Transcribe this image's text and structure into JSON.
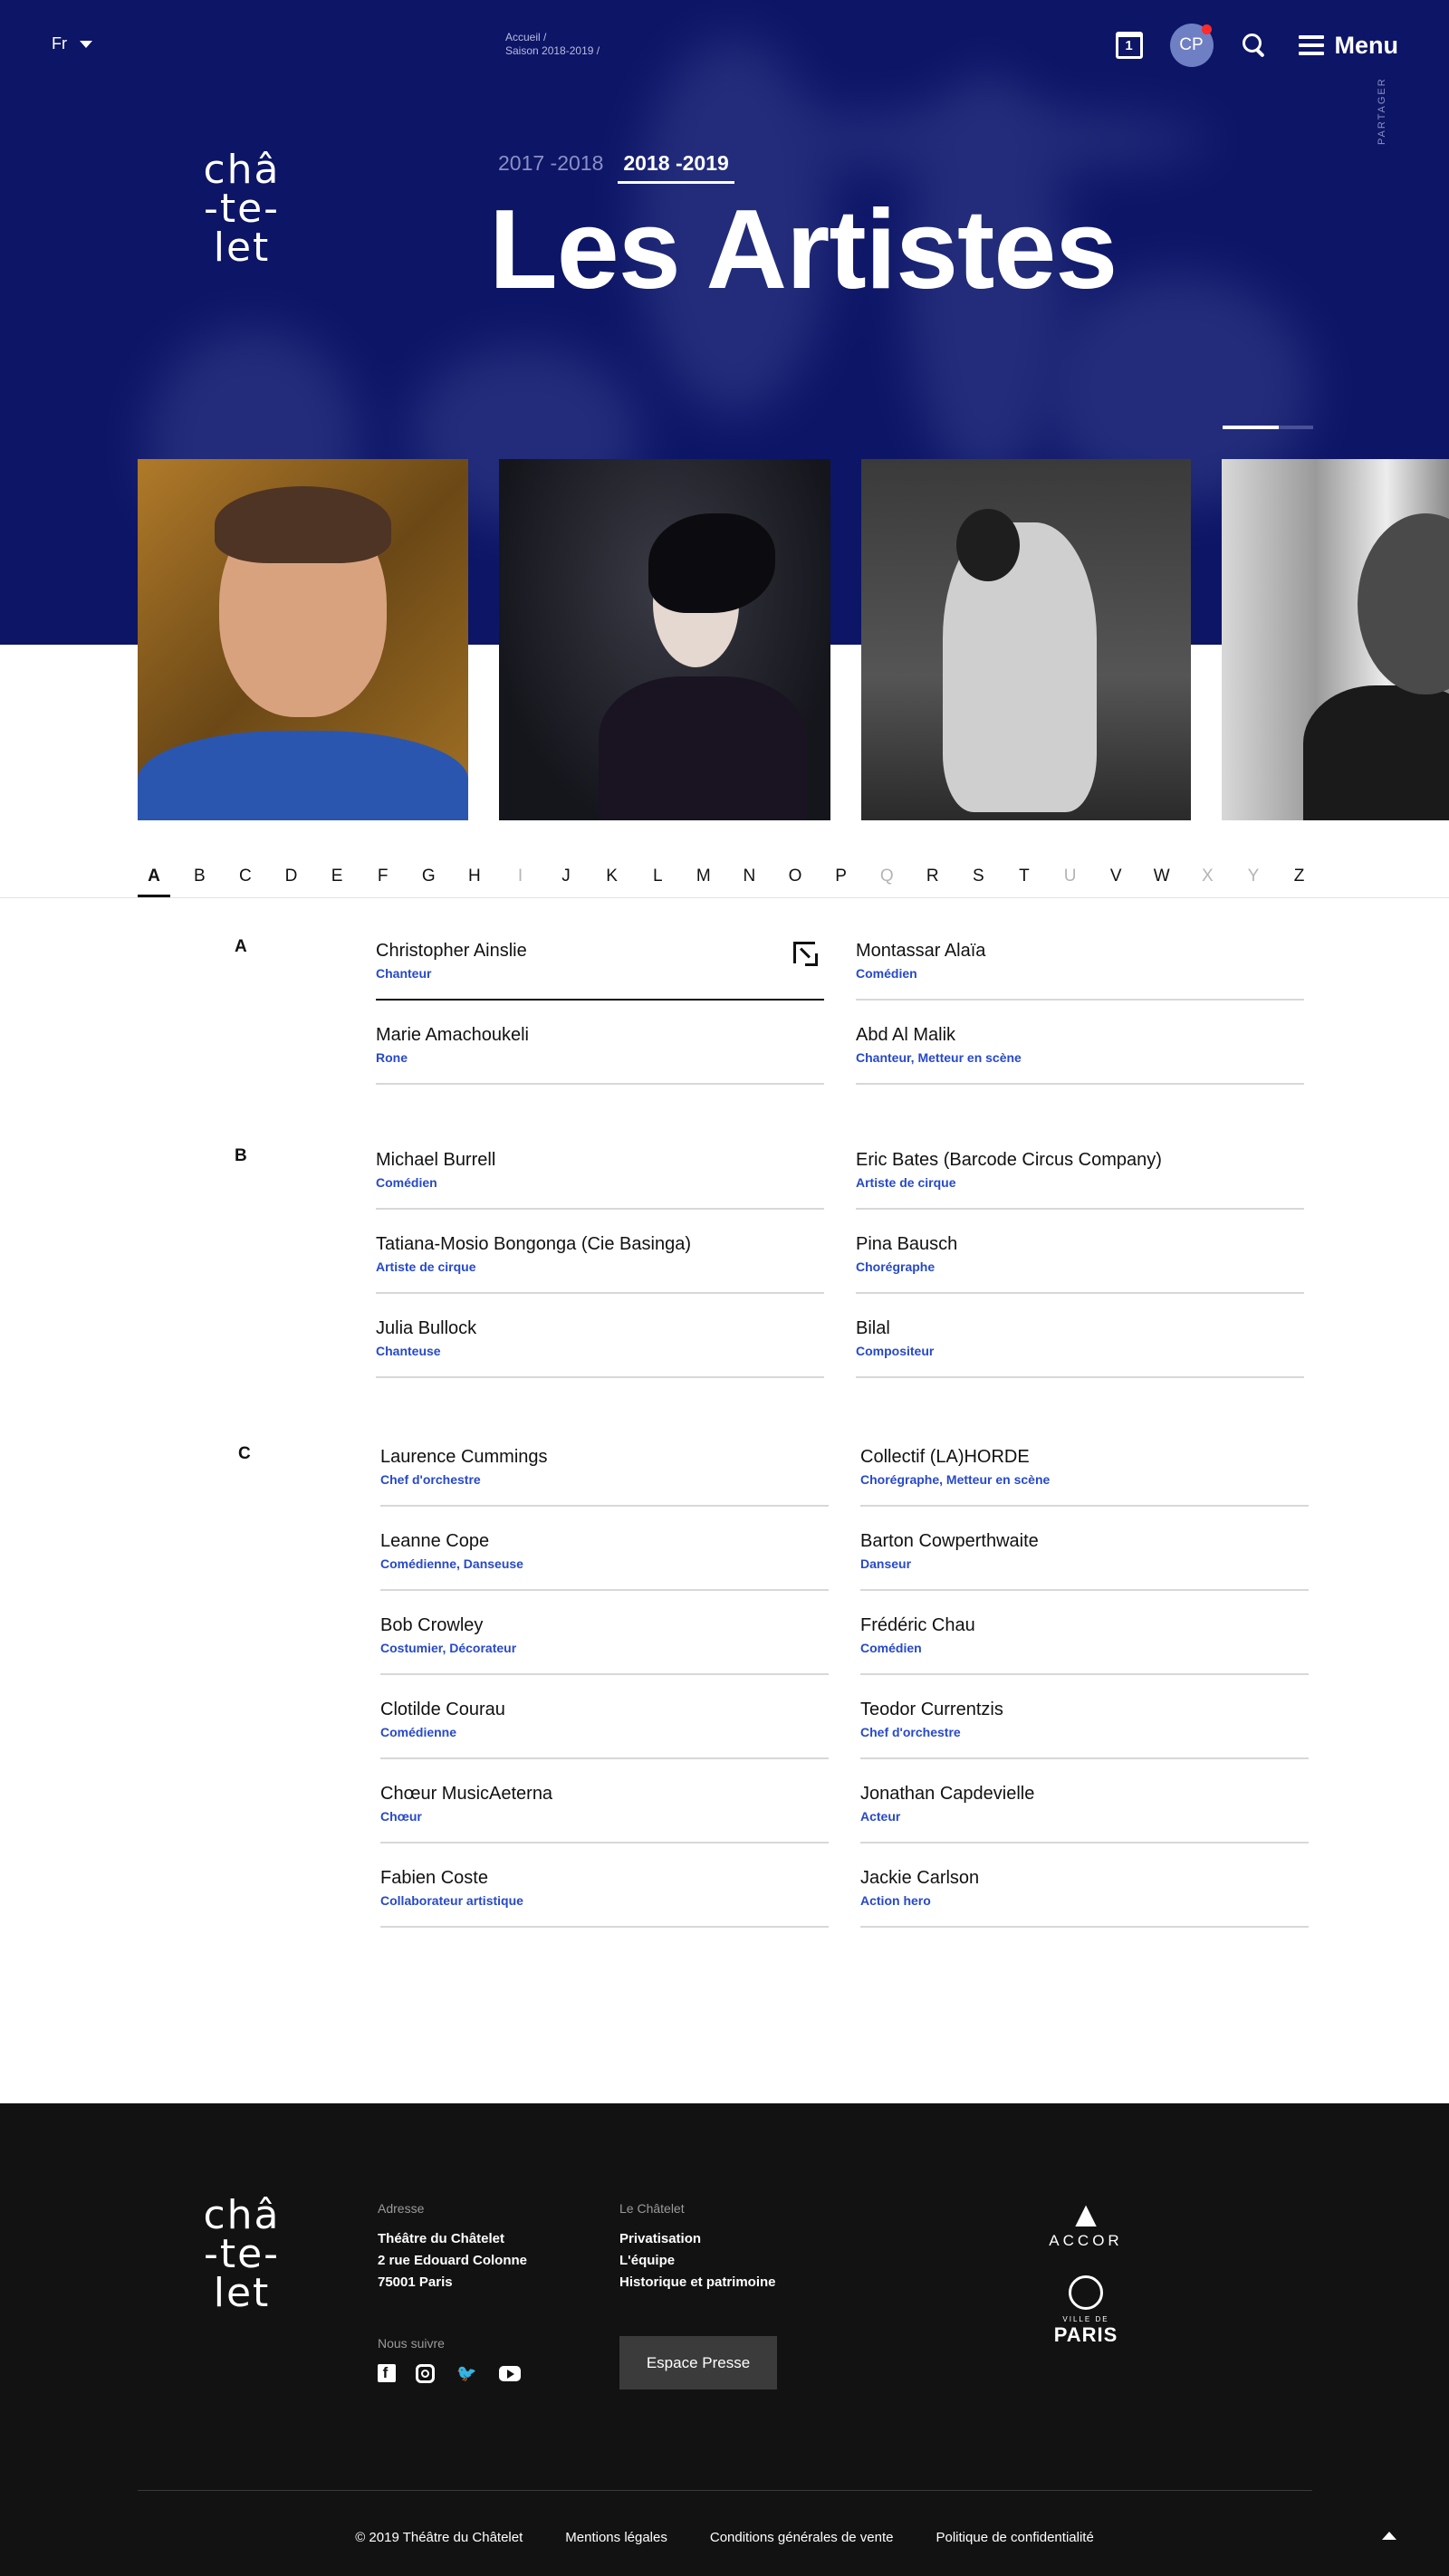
{
  "lang": "Fr",
  "breadcrumb": [
    "Accueil  /",
    "Saison 2018-2019  /"
  ],
  "header": {
    "calendar_day": "1",
    "user_initials": "CP",
    "menu_label": "Menu"
  },
  "logo_lines": [
    "châ",
    "-te-",
    "let"
  ],
  "seasons": [
    "2017 -2018",
    "2018 -2019"
  ],
  "active_season": "2018 -2019",
  "title": "Les Artistes",
  "share": "PARTAGER",
  "alphabet": [
    "A",
    "B",
    "C",
    "D",
    "E",
    "F",
    "G",
    "H",
    "I",
    "J",
    "K",
    "L",
    "M",
    "N",
    "O",
    "P",
    "Q",
    "R",
    "S",
    "T",
    "U",
    "V",
    "W",
    "X",
    "Y",
    "Z"
  ],
  "alphabet_disabled": [
    "I",
    "Q",
    "U",
    "X",
    "Y"
  ],
  "active_letter": "A",
  "sections": [
    {
      "letter": "A",
      "artists": [
        {
          "name": "Christopher Ainslie",
          "roles": "Chanteur"
        },
        {
          "name": "Montassar Alaïa",
          "roles": "Comédien"
        },
        {
          "name": "Marie Amachoukeli",
          "roles": "Rone"
        },
        {
          "name": "Abd Al Malik",
          "roles": "Chanteur,  Metteur en scène"
        }
      ]
    },
    {
      "letter": "B",
      "artists": [
        {
          "name": "Michael Burrell",
          "roles": "Comédien"
        },
        {
          "name": "Eric Bates (Barcode Circus Company)",
          "roles": "Artiste de cirque"
        },
        {
          "name": "Tatiana-Mosio Bongonga (Cie Basinga)",
          "roles": "Artiste de cirque"
        },
        {
          "name": "Pina Bausch",
          "roles": "Chorégraphe"
        },
        {
          "name": "Julia Bullock",
          "roles": "Chanteuse"
        },
        {
          "name": "Bilal",
          "roles": "Compositeur"
        }
      ]
    },
    {
      "letter": "C",
      "artists": [
        {
          "name": "Laurence Cummings",
          "roles": "Chef d'orchestre"
        },
        {
          "name": "Collectif (LA)HORDE",
          "roles": "Chorégraphe,  Metteur en scène"
        },
        {
          "name": "Leanne Cope",
          "roles": "Comédienne,  Danseuse"
        },
        {
          "name": "Barton Cowperthwaite",
          "roles": "Danseur"
        },
        {
          "name": "Bob Crowley",
          "roles": "Costumier,  Décorateur"
        },
        {
          "name": "Frédéric Chau",
          "roles": "Comédien"
        },
        {
          "name": "Clotilde Courau",
          "roles": "Comédienne"
        },
        {
          "name": "Teodor Currentzis",
          "roles": "Chef d'orchestre"
        },
        {
          "name": "Chœur MusicAeterna",
          "roles": "Chœur"
        },
        {
          "name": "Jonathan Capdevielle",
          "roles": "Acteur"
        },
        {
          "name": "Fabien Coste",
          "roles": "Collaborateur artistique"
        },
        {
          "name": "Jackie Carlson",
          "roles": "Action hero"
        }
      ]
    }
  ],
  "footer": {
    "address_label": "Adresse",
    "address_lines": [
      "Théâtre du Châtelet",
      "2 rue Edouard Colonne",
      "75001 Paris"
    ],
    "follow_label": "Nous suivre",
    "chatelet_label": "Le Châtelet",
    "chatelet_links": [
      "Privatisation",
      "L'équipe",
      "Historique et patrimoine"
    ],
    "press_button": "Espace Presse",
    "partner_accor": "ACCOR",
    "partner_paris_small": "VILLE DE",
    "partner_paris": "PARIS",
    "bottom_links": [
      "© 2019 Théâtre du Châtelet",
      "Mentions légales",
      "Conditions générales de vente",
      "Politique de confidentialité"
    ]
  },
  "colors": {
    "hero_bg": "#0d1566",
    "accent_blue": "#2749c9",
    "footer_bg": "#121212",
    "notification": "#ff2b2b"
  }
}
